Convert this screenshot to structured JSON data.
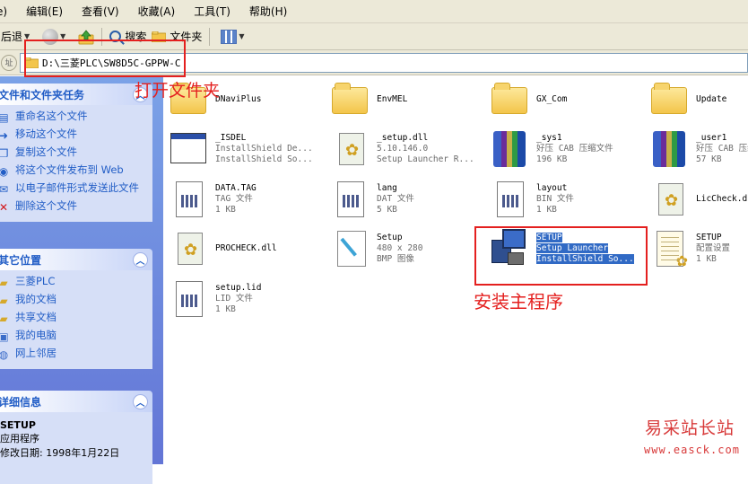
{
  "menubar": {
    "items": [
      {
        "label": "e)"
      },
      {
        "label": "编辑(E)"
      },
      {
        "label": "查看(V)"
      },
      {
        "label": "收藏(A)"
      },
      {
        "label": "工具(T)"
      },
      {
        "label": "帮助(H)"
      }
    ]
  },
  "toolbar": {
    "back_label": "后退",
    "search_label": "搜索",
    "folders_label": "文件夹"
  },
  "address": {
    "prefix": "址",
    "path": "D:\\三菱PLC\\SW8D5C-GPPW-C"
  },
  "tasks_panel": {
    "title": "文件和文件夹任务",
    "items": [
      {
        "label": "重命名这个文件",
        "icon": "rename-icon"
      },
      {
        "label": "移动这个文件",
        "icon": "move-icon"
      },
      {
        "label": "复制这个文件",
        "icon": "copy-icon"
      },
      {
        "label": "将这个文件发布到 Web",
        "icon": "publish-web-icon"
      },
      {
        "label": "以电子邮件形式发送此文件",
        "icon": "email-icon"
      },
      {
        "label": "删除这个文件",
        "icon": "delete-icon"
      }
    ]
  },
  "places_panel": {
    "title": "其它位置",
    "items": [
      {
        "label": "三菱PLC",
        "icon": "folder-icon"
      },
      {
        "label": "我的文档",
        "icon": "my-documents-icon"
      },
      {
        "label": "共享文档",
        "icon": "shared-documents-icon"
      },
      {
        "label": "我的电脑",
        "icon": "my-computer-icon"
      },
      {
        "label": "网上邻居",
        "icon": "network-icon"
      }
    ]
  },
  "details_panel": {
    "title": "详细信息",
    "name": "SETUP",
    "type": "应用程序",
    "modified": "修改日期: 1998年1月22日"
  },
  "files": [
    {
      "name": "DNaviPlus",
      "line2": "",
      "line3": "",
      "icon": "folder-icon"
    },
    {
      "name": "EnvMEL",
      "line2": "",
      "line3": "",
      "icon": "folder-icon"
    },
    {
      "name": "GX_Com",
      "line2": "",
      "line3": "",
      "icon": "folder-icon"
    },
    {
      "name": "Update",
      "line2": "",
      "line3": "",
      "icon": "folder-icon"
    },
    {
      "name": "_ISDEL",
      "line2": "InstallShield De...",
      "line3": "InstallShield So...",
      "icon": "window-icon"
    },
    {
      "name": "_setup.dll",
      "line2": "5.10.146.0",
      "line3": "Setup Launcher R...",
      "icon": "dll-gear-icon"
    },
    {
      "name": "_sys1",
      "line2": "好压 CAB 压缩文件",
      "line3": "196 KB",
      "icon": "archive-icon"
    },
    {
      "name": "_user1",
      "line2": "好压 CAB 压缩",
      "line3": "57 KB",
      "icon": "archive-icon"
    },
    {
      "name": "DATA.TAG",
      "line2": "TAG 文件",
      "line3": "1 KB",
      "icon": "document-icon"
    },
    {
      "name": "lang",
      "line2": "DAT 文件",
      "line3": "5 KB",
      "icon": "document-icon"
    },
    {
      "name": "layout",
      "line2": "BIN 文件",
      "line3": "1 KB",
      "icon": "document-icon"
    },
    {
      "name": "LicCheck.d",
      "line2": "",
      "line3": "",
      "icon": "dll-gear-icon"
    },
    {
      "name": "PROCHECK.dll",
      "line2": "",
      "line3": "",
      "icon": "dll-gear-icon"
    },
    {
      "name": "Setup",
      "line2": "480 x 280",
      "line3": "BMP 图像",
      "icon": "bitmap-icon"
    },
    {
      "name": "SETUP",
      "line2": "Setup Launcher",
      "line3": "InstallShield So...",
      "icon": "setup-program-icon",
      "selected": true
    },
    {
      "name": "SETUP",
      "line2": "配置设置",
      "line3": "1 KB",
      "icon": "config-settings-icon"
    },
    {
      "name": "setup.lid",
      "line2": "LID 文件",
      "line3": "1 KB",
      "icon": "document-icon"
    }
  ],
  "annotations": {
    "open_folder": "打开文件夹",
    "main_program": "安装主程序"
  },
  "watermark": {
    "site_name": "易采站长站",
    "url": "www.easck.com"
  },
  "colors": {
    "annotation_red": "#e4201f",
    "selection_blue": "#316ac5",
    "taskpane_blue": "#6375d6",
    "link_blue": "#215dc6"
  }
}
